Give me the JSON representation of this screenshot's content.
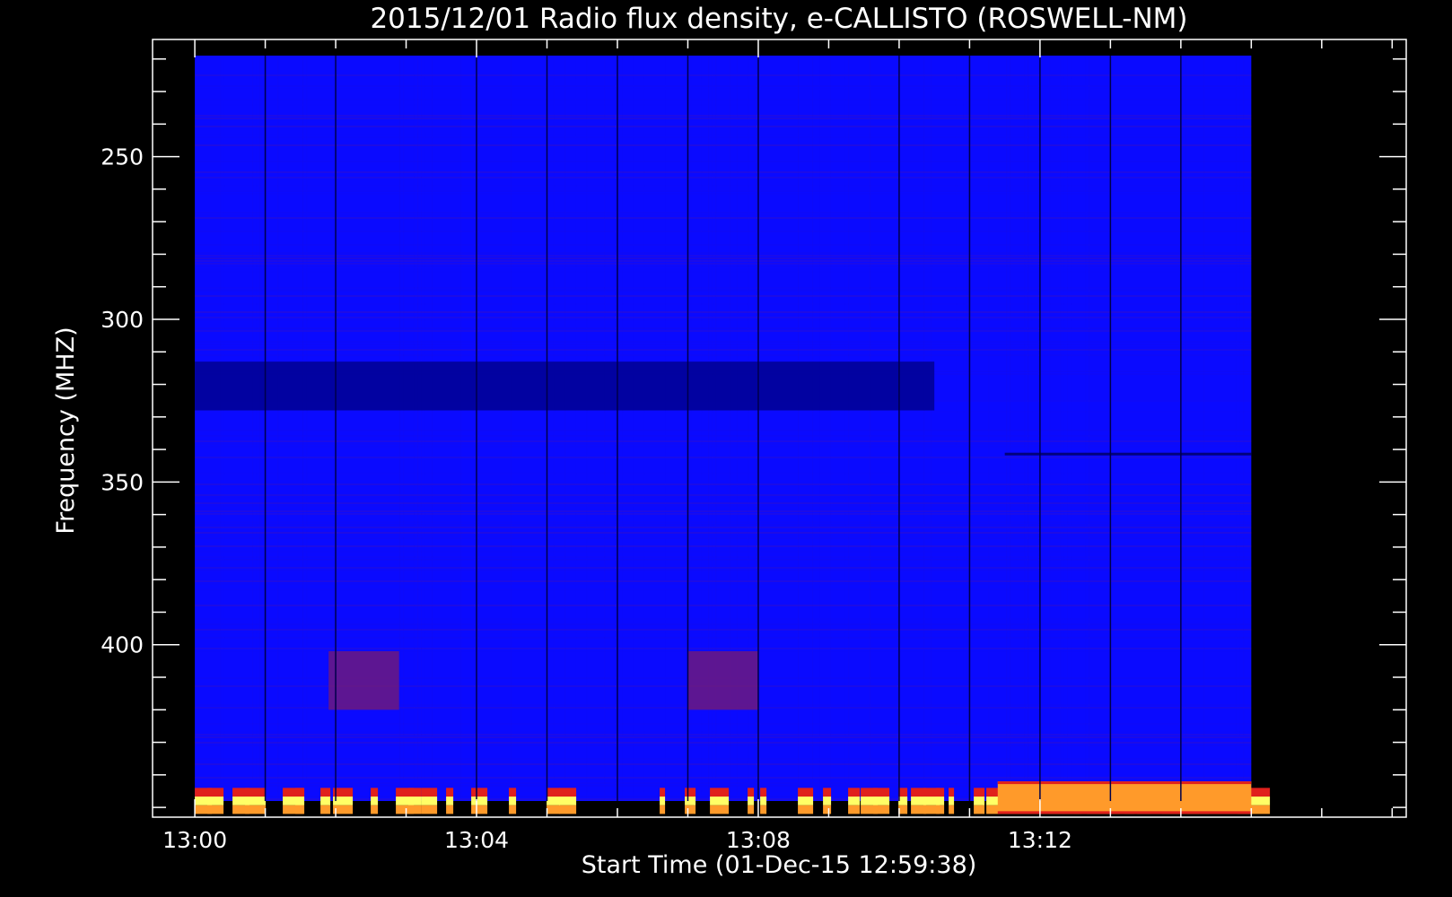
{
  "chart_data": {
    "type": "heatmap",
    "title": "2015/12/01  Radio flux density, e-CALLISTO (ROSWELL-NM)",
    "xlabel": "Start Time (01-Dec-15 12:59:38)",
    "ylabel": "Frequency (MHZ)",
    "x_ticks": [
      "13:00",
      "13:04",
      "13:08",
      "13:12"
    ],
    "y_ticks": [
      250,
      300,
      350,
      400
    ],
    "y_range_mhz": [
      214,
      453
    ],
    "y_axis_inverted": true,
    "x_range_min": [
      12.4,
      30.2
    ],
    "data_extent_min": [
      13.0,
      28.0
    ],
    "colormap": [
      "#0a0aff",
      "#7a1b6e",
      "#e0201c",
      "#ff9a2a",
      "#ffff66"
    ],
    "background_color": "#0a0aff",
    "scan_boundaries_min": [
      14.0,
      15.0,
      17.0,
      18.0,
      19.0,
      20.0,
      21.0,
      23.0,
      24.0,
      25.0,
      26.0,
      27.0
    ],
    "features": [
      {
        "name": "dark band",
        "freq_mhz_start": 313,
        "freq_mhz_end": 328,
        "t_start_min": 13.0,
        "t_end_min": 23.5
      },
      {
        "name": "dark line",
        "freq_mhz_start": 341,
        "freq_mhz_end": 341,
        "t_start_min": 24.5,
        "t_end_min": 28.0
      },
      {
        "name": "enhanced emission",
        "freq_mhz_start": 402,
        "freq_mhz_end": 420,
        "t_start_min": 14.9,
        "t_end_min": 15.9
      },
      {
        "name": "enhanced emission",
        "freq_mhz_start": 402,
        "freq_mhz_end": 420,
        "t_start_min": 20.0,
        "t_end_min": 21.0
      },
      {
        "name": "bright interference",
        "freq_mhz_start": 444,
        "freq_mhz_end": 452,
        "t_start_min": 13.0,
        "t_end_min": 28.0
      },
      {
        "name": "continuous interference",
        "freq_mhz_start": 442,
        "freq_mhz_end": 452,
        "t_start_min": 24.4,
        "t_end_min": 28.0
      }
    ]
  }
}
